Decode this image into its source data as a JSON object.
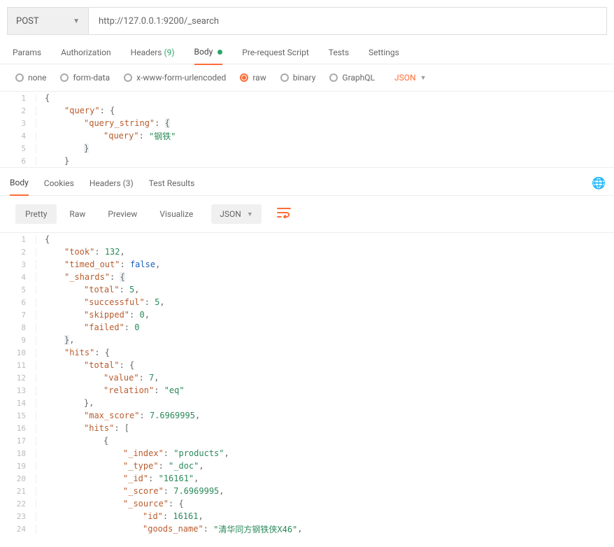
{
  "request": {
    "method": "POST",
    "url": "http://127.0.0.1:9200/_search"
  },
  "tabs": {
    "params": "Params",
    "auth": "Authorization",
    "headers": "Headers",
    "headers_count": "(9)",
    "body": "Body",
    "prereq": "Pre-request Script",
    "tests": "Tests",
    "settings": "Settings"
  },
  "body_types": {
    "none": "none",
    "form_data": "form-data",
    "urlencoded": "x-www-form-urlencoded",
    "raw": "raw",
    "binary": "binary",
    "graphql": "GraphQL",
    "format": "JSON"
  },
  "req_body": {
    "lines": [
      {
        "n": "1",
        "g": 0,
        "seg": [
          {
            "c": "p",
            "t": "{"
          }
        ]
      },
      {
        "n": "2",
        "g": 1,
        "seg": [
          {
            "c": "k",
            "t": "\"query\""
          },
          {
            "c": "p",
            "t": ": {"
          }
        ]
      },
      {
        "n": "3",
        "g": 2,
        "seg": [
          {
            "c": "k",
            "t": "\"query_string\""
          },
          {
            "c": "p",
            "t": ": "
          },
          {
            "c": "p hl",
            "t": "{"
          }
        ]
      },
      {
        "n": "4",
        "g": 3,
        "seg": [
          {
            "c": "k",
            "t": "\"query\""
          },
          {
            "c": "p",
            "t": ": "
          },
          {
            "c": "s",
            "t": "\"钢铁\""
          }
        ]
      },
      {
        "n": "5",
        "g": 2,
        "seg": [
          {
            "c": "p hl",
            "t": "}"
          }
        ]
      },
      {
        "n": "6",
        "g": 1,
        "seg": [
          {
            "c": "p",
            "t": "}"
          }
        ]
      }
    ]
  },
  "resp_tabs": {
    "body": "Body",
    "cookies": "Cookies",
    "headers": "Headers",
    "headers_count": "(3)",
    "tests": "Test Results"
  },
  "resp_toolbar": {
    "pretty": "Pretty",
    "raw": "Raw",
    "preview": "Preview",
    "visualize": "Visualize",
    "fmt": "JSON"
  },
  "resp_body": {
    "lines": [
      {
        "n": "1",
        "g": 0,
        "seg": [
          {
            "c": "p",
            "t": "{"
          }
        ]
      },
      {
        "n": "2",
        "g": 1,
        "seg": [
          {
            "c": "k",
            "t": "\"took\""
          },
          {
            "c": "p",
            "t": ": "
          },
          {
            "c": "n",
            "t": "132"
          },
          {
            "c": "p",
            "t": ","
          }
        ]
      },
      {
        "n": "3",
        "g": 1,
        "seg": [
          {
            "c": "k",
            "t": "\"timed_out\""
          },
          {
            "c": "p",
            "t": ": "
          },
          {
            "c": "b",
            "t": "false"
          },
          {
            "c": "p",
            "t": ","
          }
        ]
      },
      {
        "n": "4",
        "g": 1,
        "seg": [
          {
            "c": "k",
            "t": "\"_shards\""
          },
          {
            "c": "p",
            "t": ": "
          },
          {
            "c": "p hl",
            "t": "{"
          }
        ]
      },
      {
        "n": "5",
        "g": 2,
        "seg": [
          {
            "c": "k",
            "t": "\"total\""
          },
          {
            "c": "p",
            "t": ": "
          },
          {
            "c": "n",
            "t": "5"
          },
          {
            "c": "p",
            "t": ","
          }
        ]
      },
      {
        "n": "6",
        "g": 2,
        "seg": [
          {
            "c": "k",
            "t": "\"successful\""
          },
          {
            "c": "p",
            "t": ": "
          },
          {
            "c": "n",
            "t": "5"
          },
          {
            "c": "p",
            "t": ","
          }
        ]
      },
      {
        "n": "7",
        "g": 2,
        "seg": [
          {
            "c": "k",
            "t": "\"skipped\""
          },
          {
            "c": "p",
            "t": ": "
          },
          {
            "c": "n",
            "t": "0"
          },
          {
            "c": "p",
            "t": ","
          }
        ]
      },
      {
        "n": "8",
        "g": 2,
        "seg": [
          {
            "c": "k",
            "t": "\"failed\""
          },
          {
            "c": "p",
            "t": ": "
          },
          {
            "c": "n",
            "t": "0"
          }
        ]
      },
      {
        "n": "9",
        "g": 1,
        "seg": [
          {
            "c": "p hl",
            "t": "}"
          },
          {
            "c": "p",
            "t": ","
          }
        ]
      },
      {
        "n": "10",
        "g": 1,
        "seg": [
          {
            "c": "k",
            "t": "\"hits\""
          },
          {
            "c": "p",
            "t": ": {"
          }
        ]
      },
      {
        "n": "11",
        "g": 2,
        "seg": [
          {
            "c": "k",
            "t": "\"total\""
          },
          {
            "c": "p",
            "t": ": {"
          }
        ]
      },
      {
        "n": "12",
        "g": 3,
        "seg": [
          {
            "c": "k",
            "t": "\"value\""
          },
          {
            "c": "p",
            "t": ": "
          },
          {
            "c": "n",
            "t": "7"
          },
          {
            "c": "p",
            "t": ","
          }
        ]
      },
      {
        "n": "13",
        "g": 3,
        "seg": [
          {
            "c": "k",
            "t": "\"relation\""
          },
          {
            "c": "p",
            "t": ": "
          },
          {
            "c": "s",
            "t": "\"eq\""
          }
        ]
      },
      {
        "n": "14",
        "g": 2,
        "seg": [
          {
            "c": "p",
            "t": "},"
          }
        ]
      },
      {
        "n": "15",
        "g": 2,
        "seg": [
          {
            "c": "k",
            "t": "\"max_score\""
          },
          {
            "c": "p",
            "t": ": "
          },
          {
            "c": "n",
            "t": "7.6969995"
          },
          {
            "c": "p",
            "t": ","
          }
        ]
      },
      {
        "n": "16",
        "g": 2,
        "seg": [
          {
            "c": "k",
            "t": "\"hits\""
          },
          {
            "c": "p",
            "t": ": ["
          }
        ]
      },
      {
        "n": "17",
        "g": 3,
        "seg": [
          {
            "c": "p",
            "t": "{"
          }
        ]
      },
      {
        "n": "18",
        "g": 4,
        "seg": [
          {
            "c": "k",
            "t": "\"_index\""
          },
          {
            "c": "p",
            "t": ": "
          },
          {
            "c": "s",
            "t": "\"products\""
          },
          {
            "c": "p",
            "t": ","
          }
        ]
      },
      {
        "n": "19",
        "g": 4,
        "seg": [
          {
            "c": "k",
            "t": "\"_type\""
          },
          {
            "c": "p",
            "t": ": "
          },
          {
            "c": "s",
            "t": "\"_doc\""
          },
          {
            "c": "p",
            "t": ","
          }
        ]
      },
      {
        "n": "20",
        "g": 4,
        "seg": [
          {
            "c": "k",
            "t": "\"_id\""
          },
          {
            "c": "p",
            "t": ": "
          },
          {
            "c": "s",
            "t": "\"16161\""
          },
          {
            "c": "p",
            "t": ","
          }
        ]
      },
      {
        "n": "21",
        "g": 4,
        "seg": [
          {
            "c": "k",
            "t": "\"_score\""
          },
          {
            "c": "p",
            "t": ": "
          },
          {
            "c": "n",
            "t": "7.6969995"
          },
          {
            "c": "p",
            "t": ","
          }
        ]
      },
      {
        "n": "22",
        "g": 4,
        "seg": [
          {
            "c": "k",
            "t": "\"_source\""
          },
          {
            "c": "p",
            "t": ": {"
          }
        ]
      },
      {
        "n": "23",
        "g": 5,
        "seg": [
          {
            "c": "k",
            "t": "\"id\""
          },
          {
            "c": "p",
            "t": ": "
          },
          {
            "c": "n",
            "t": "16161"
          },
          {
            "c": "p",
            "t": ","
          }
        ]
      },
      {
        "n": "24",
        "g": 5,
        "seg": [
          {
            "c": "k",
            "t": "\"goods_name\""
          },
          {
            "c": "p",
            "t": ": "
          },
          {
            "c": "s",
            "t": "\"清华同方钢铁侠X46\""
          },
          {
            "c": "p",
            "t": ","
          }
        ]
      }
    ]
  }
}
